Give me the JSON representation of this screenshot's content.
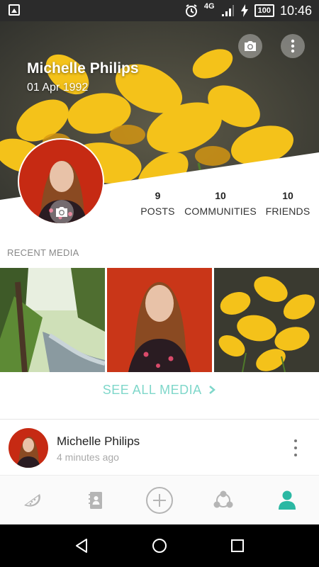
{
  "status_bar": {
    "network": "4G",
    "battery": "100",
    "time": "10:46"
  },
  "profile": {
    "name": "Michelle Philips",
    "date": "01 Apr 1992"
  },
  "stats": {
    "posts": {
      "value": "9",
      "label": "POSTS"
    },
    "communities": {
      "value": "10",
      "label": "COMMUNITIES"
    },
    "friends": {
      "value": "10",
      "label": "FRIENDS"
    }
  },
  "recent_media": {
    "title": "RECENT MEDIA",
    "see_all": "SEE ALL MEDIA"
  },
  "post": {
    "author": "Michelle Philips",
    "time": "4 minutes ago"
  },
  "colors": {
    "accent": "#7fd7ca",
    "active_tab": "#2bb8a3",
    "inactive_icon": "#b5b5b5"
  },
  "tabs": [
    {
      "icon": "watermelon-icon",
      "active": false
    },
    {
      "icon": "contacts-book-icon",
      "active": false
    },
    {
      "icon": "add-circle-icon",
      "active": false
    },
    {
      "icon": "communities-icon",
      "active": false
    },
    {
      "icon": "profile-icon",
      "active": true
    }
  ]
}
